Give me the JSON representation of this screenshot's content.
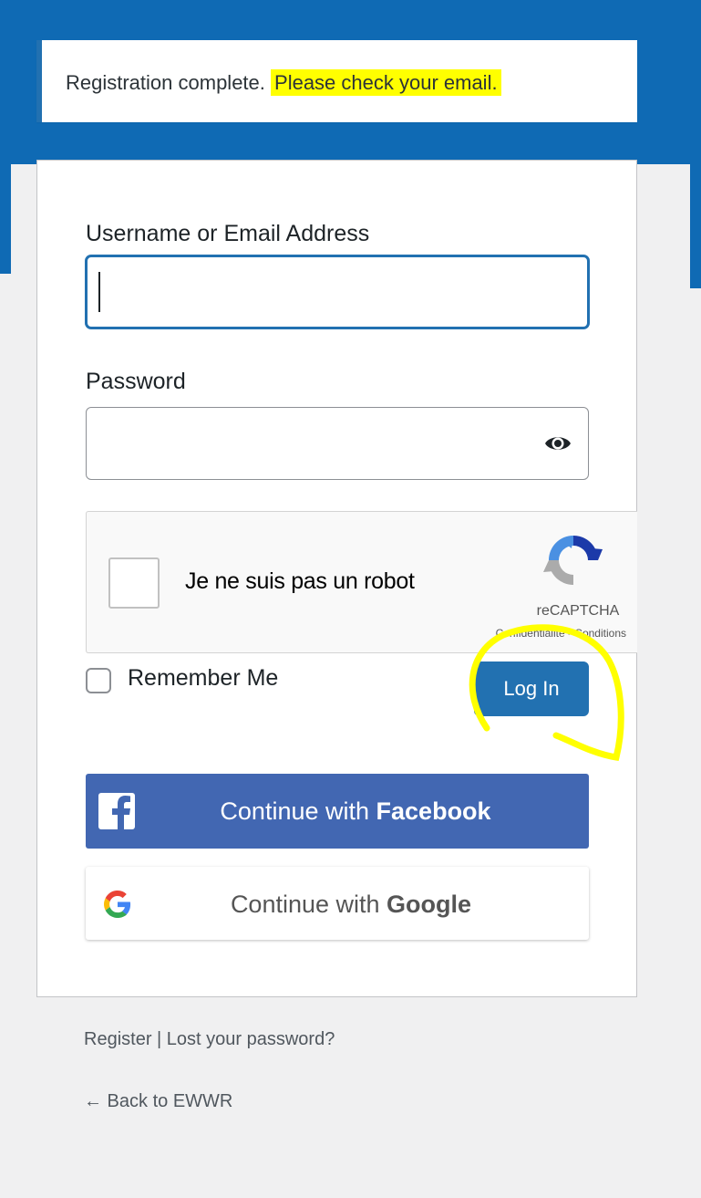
{
  "notice": {
    "text": "Registration complete.",
    "highlighted": "Please check your email."
  },
  "form": {
    "username_label": "Username or Email Address",
    "username_value": "",
    "password_label": "Password",
    "password_value": "",
    "recaptcha": {
      "label": "Je ne suis pas un robot",
      "brand": "reCAPTCHA",
      "terms": "Confidentialité - Conditions"
    },
    "remember_label": "Remember Me",
    "login_label": "Log In"
  },
  "social": {
    "facebook_prefix": "Continue with ",
    "facebook_name": "Facebook",
    "google_prefix": "Continue with ",
    "google_name": "Google"
  },
  "links": {
    "register": "Register",
    "separator": " | ",
    "lost_password": "Lost your password?",
    "back": "← Back to EWWR"
  },
  "icons": {
    "password_toggle": "eye-icon",
    "recaptcha_logo": "recaptcha-logo-icon",
    "facebook": "facebook-icon",
    "google": "google-icon"
  },
  "colors": {
    "primary": "#2271b1",
    "facebook": "#4267b2",
    "highlight": "#ffff00",
    "background_blue": "#0f6ab4"
  }
}
